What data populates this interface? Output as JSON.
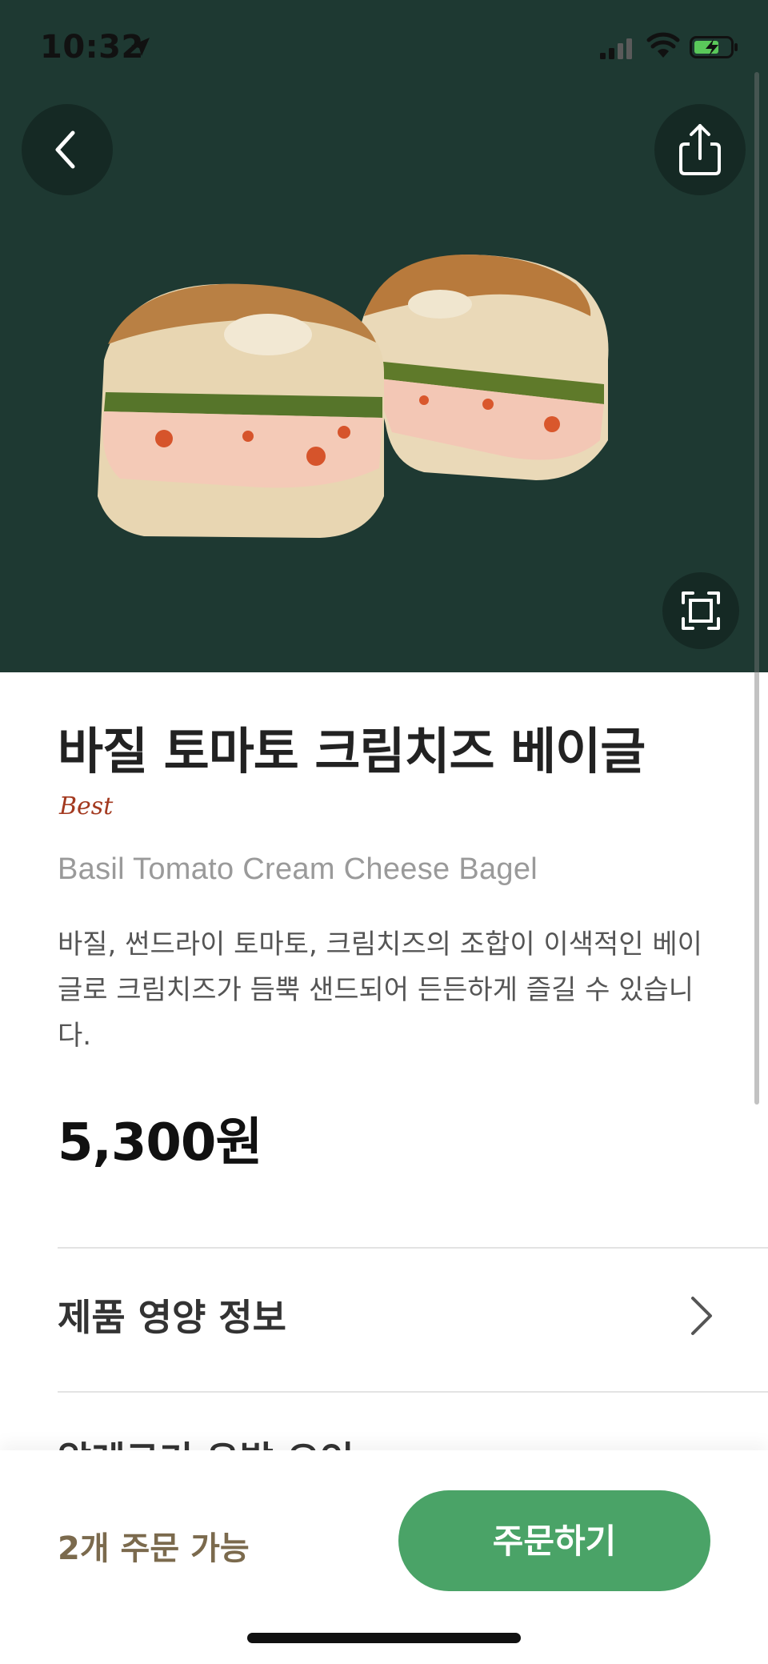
{
  "status_bar": {
    "time": "10:32",
    "icons": [
      "location-arrow-icon",
      "cellular-signal-icon",
      "wifi-icon",
      "battery-charging-icon"
    ]
  },
  "header": {
    "back_icon": "chevron-left-icon",
    "share_icon": "share-icon",
    "expand_icon": "fullscreen-icon"
  },
  "product": {
    "name": "바질 토마토 크림치즈 베이글",
    "badge": "Best",
    "english_name": "Basil Tomato Cream Cheese Bagel",
    "description": "바질, 썬드라이 토마토, 크림치즈의 조합이 이색적인 베이글로 크림치즈가 듬뿍 샌드되어 든든하게 즐길 수 있습니다.",
    "price": "5,300원"
  },
  "sections": {
    "nutrition_label": "제품 영양 정보",
    "allergy_label": "알레르기 유발 요인"
  },
  "bottom_bar": {
    "available": "2개 주문 가능",
    "order_button": "주문하기"
  },
  "colors": {
    "hero_background": "#1e3932",
    "badge": "#a3391f",
    "order_button": "#4aa367",
    "available_text": "#7b6a4d"
  }
}
